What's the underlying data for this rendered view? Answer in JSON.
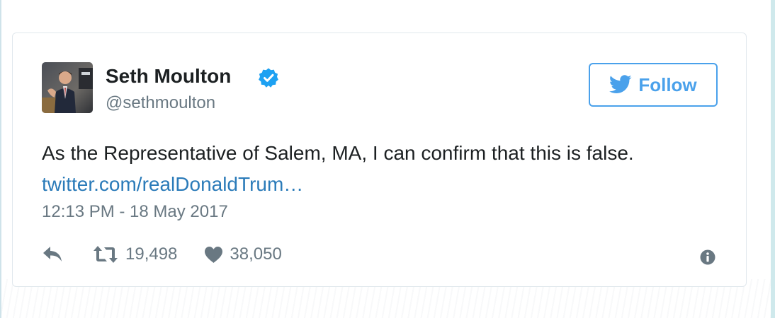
{
  "author": {
    "name": "Seth Moulton",
    "handle": "@sethmoulton",
    "verified": true,
    "avatar": "profile-photo"
  },
  "follow_button": {
    "label": "Follow",
    "icon": "twitter-bird-icon",
    "color": "#4aa1eb"
  },
  "tweet": {
    "text": "As the Representative of Salem, MA, I can confirm that this is false.",
    "link": "twitter.com/realDonaldTrum…",
    "timestamp": "12:13 PM - 18 May 2017"
  },
  "actions": {
    "reply_icon": "reply-icon",
    "retweets": "19,498",
    "likes": "38,050",
    "info_icon": "info-icon"
  },
  "colors": {
    "text": "#1c2022",
    "muted": "#697882",
    "link": "#2b7bb9",
    "verified": "#1da1f2"
  }
}
